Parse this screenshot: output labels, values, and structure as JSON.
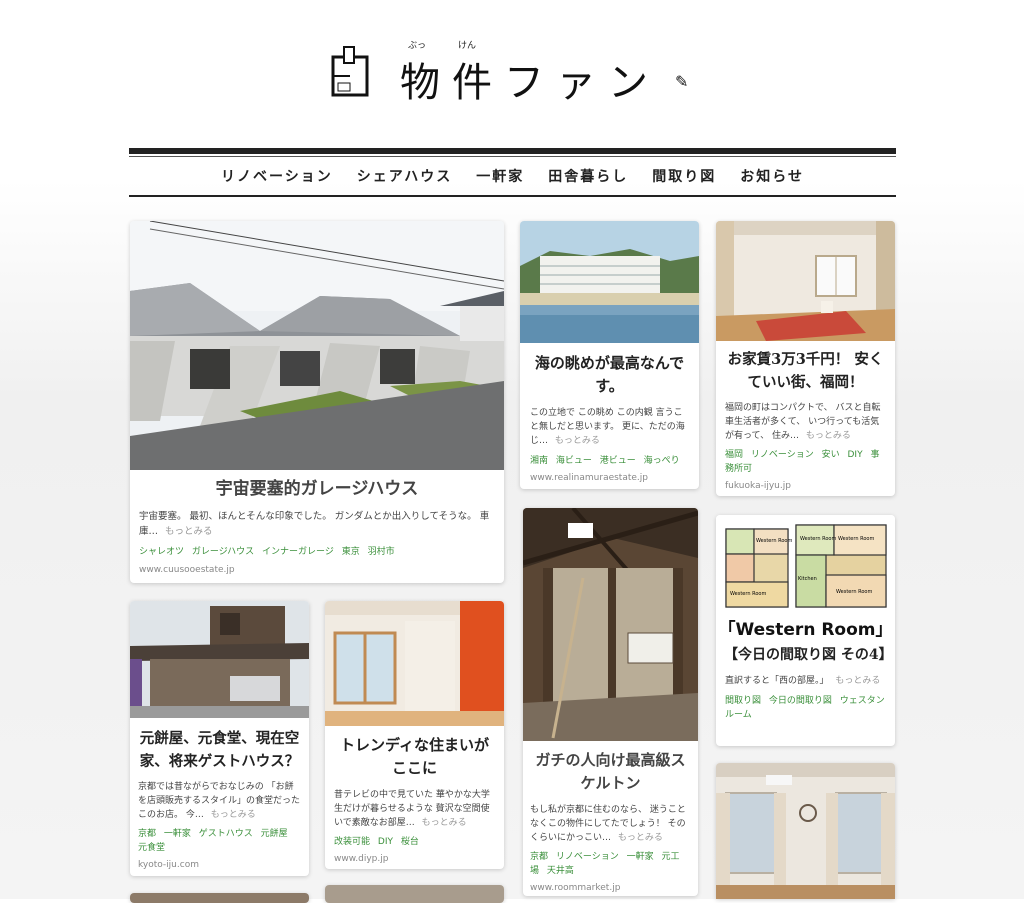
{
  "logo": {
    "ruby_1": "ぶっ",
    "ruby_2": "けん",
    "text": "物件ファン"
  },
  "nav": [
    "リノベーション",
    "シェアハウス",
    "一軒家",
    "田舎暮らし",
    "間取り図",
    "お知らせ"
  ],
  "more_label": "もっとみる",
  "cards": [
    {
      "title": "宇宙要塞的ガレージハウス",
      "desc": "宇宙要塞。 最初、ほんとそんな印象でした。 ガンダムとか出入りしてそうな。 車庫…",
      "tags": [
        "シャレオツ",
        "ガレージハウス",
        "インナーガレージ",
        "東京",
        "羽村市"
      ],
      "source": "www.cuusooestate.jp"
    },
    {
      "title": "海の眺めが最高なんです。",
      "desc": "この立地で この眺め この内観 言うこと無しだと思います。 更に、ただの海じ…",
      "tags": [
        "湘南",
        "海ビュー",
        "港ビュー",
        "海っぺり"
      ],
      "source": "www.realinamuraestate.jp"
    },
    {
      "title": "お家賃3万3千円！ 安くていい街、福岡！",
      "desc": "福岡の町はコンパクトで、 バスと自転車生活者が多くて、 いつ行っても活気が有って、 住み…",
      "tags": [
        "福岡",
        "リノベーション",
        "安い",
        "DIY",
        "事務所可"
      ],
      "source": "fukuoka-ijyu.jp"
    },
    {
      "title": "ガチの人向け最高級スケルトン",
      "desc": "もし私が京都に住むのなら、 迷うことなくこの物件にしてたでしょう！ そのくらいにかっこい…",
      "tags": [
        "京都",
        "リノベーション",
        "一軒家",
        "元工場",
        "天井高"
      ],
      "source": "www.roommarket.jp"
    },
    {
      "title": "【今日の間取り図 その4】",
      "image_label": "「Western Room」",
      "desc": "直訳すると「西の部屋。」",
      "tags": [
        "間取り図",
        "今日の間取り図",
        "ウェスタンルーム"
      ],
      "source": ""
    },
    {
      "title": "元餅屋、元食堂、現在空家、将来ゲストハウス？",
      "desc": "京都では昔ながらでおなじみの 「お餅を店頭販売するスタイル」の食堂だったこのお店。 今…",
      "tags": [
        "京都",
        "一軒家",
        "ゲストハウス",
        "元餅屋",
        "元食堂"
      ],
      "source": "kyoto-iju.com"
    },
    {
      "title": "トレンディな住まいがここに",
      "desc": "昔テレビの中で見ていた 華やかな大学生だけが暮らせるような 贅沢な空間使いで素敵なお部屋…",
      "tags": [
        "改装可能",
        "DIY",
        "桜台"
      ],
      "source": "www.diyp.jp"
    }
  ],
  "floorplan_labels": [
    "Western Room",
    "Western Room",
    "Western Room",
    "Western Room",
    "Western Room",
    "Kitchen"
  ]
}
